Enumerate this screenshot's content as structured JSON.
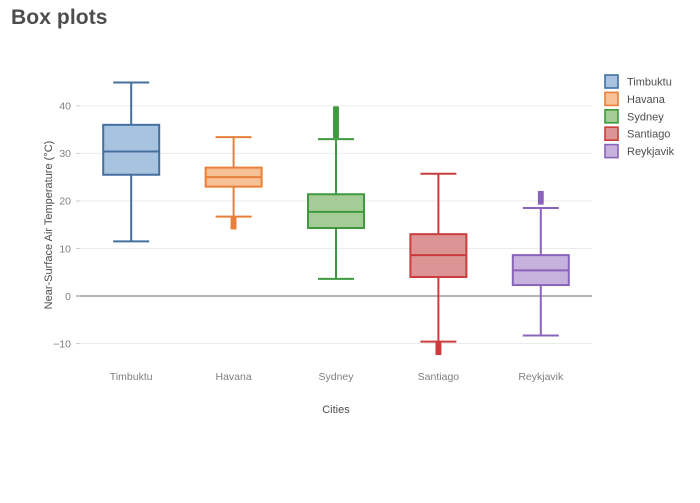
{
  "header": {
    "title": "Box plots"
  },
  "chart_data": {
    "type": "box",
    "title": "Box plots",
    "xlabel": "Cities",
    "ylabel": "Near-Surface Air Temperature (°C)",
    "categories": [
      "Timbuktu",
      "Havana",
      "Sydney",
      "Santiago",
      "Reykjavik"
    ],
    "ylim": [
      -14,
      47
    ],
    "yticks": [
      -10,
      0,
      10,
      20,
      30,
      40
    ],
    "ytick_labels": [
      "−10",
      "0",
      "10",
      "20",
      "30",
      "40"
    ],
    "grid": true,
    "zero_line": true,
    "legend_position": "right",
    "colors": {
      "Timbuktu": {
        "fill": "#a7c3e0",
        "line": "#44709f"
      },
      "Havana": {
        "fill": "#f8c195",
        "line": "#e8803a"
      },
      "Sydney": {
        "fill": "#a5cc96",
        "line": "#3f9a3f"
      },
      "Santiago": {
        "fill": "#dd9494",
        "line": "#cc3c3c"
      },
      "Reykjavik": {
        "fill": "#c6b2dd",
        "line": "#8a63bb"
      }
    },
    "series": [
      {
        "name": "Timbuktu",
        "lower_whisker": 11.5,
        "q1": 25.5,
        "median": 30.4,
        "q3": 36.0,
        "upper_whisker": 44.9,
        "outliers": []
      },
      {
        "name": "Havana",
        "lower_whisker": 16.7,
        "q1": 23.0,
        "median": 25.0,
        "q3": 27.0,
        "upper_whisker": 33.4,
        "outliers": [
          16.2,
          15.8,
          15.5,
          15.2,
          14.9,
          14.6,
          14.4
        ]
      },
      {
        "name": "Sydney",
        "lower_whisker": 3.6,
        "q1": 14.3,
        "median": 17.7,
        "q3": 21.4,
        "upper_whisker": 33.0,
        "outliers": [
          33.6,
          34.2,
          34.8,
          35.4,
          36.0,
          36.6,
          37.2,
          37.8,
          38.4,
          39.0,
          39.5
        ]
      },
      {
        "name": "Santiago",
        "lower_whisker": -9.6,
        "q1": 4.0,
        "median": 8.6,
        "q3": 13.0,
        "upper_whisker": 25.7,
        "outliers": [
          -10.1,
          -10.5,
          -10.9,
          -11.3,
          -11.7,
          -12.0
        ]
      },
      {
        "name": "Reykjavik",
        "lower_whisker": -8.3,
        "q1": 2.3,
        "median": 5.4,
        "q3": 8.6,
        "upper_whisker": 18.5,
        "outliers": [
          19.6,
          20.2,
          20.8,
          21.3,
          21.7
        ]
      }
    ]
  },
  "legend": {
    "items": [
      {
        "label": "Timbuktu",
        "color": "#a7c3e0",
        "border": "#44709f"
      },
      {
        "label": "Havana",
        "color": "#f8c195",
        "border": "#e8803a"
      },
      {
        "label": "Sydney",
        "color": "#a5cc96",
        "border": "#3f9a3f"
      },
      {
        "label": "Santiago",
        "color": "#dd9494",
        "border": "#cc3c3c"
      },
      {
        "label": "Reykjavik",
        "color": "#c6b2dd",
        "border": "#8a63bb"
      }
    ]
  }
}
